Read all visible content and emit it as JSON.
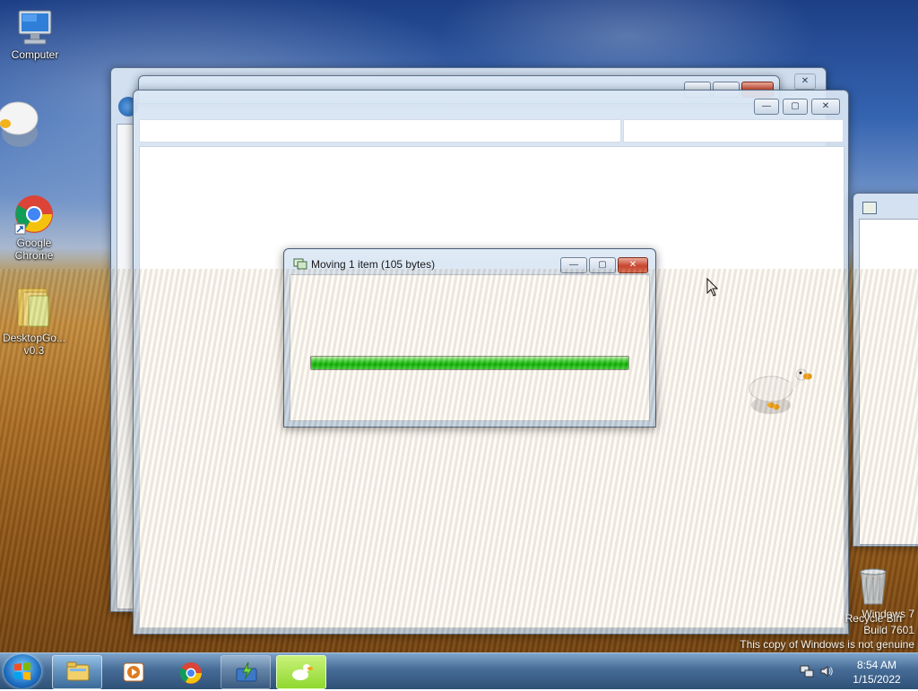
{
  "desktop": {
    "icons": [
      {
        "label": "Computer"
      },
      {
        "label": "Google\nChrome"
      },
      {
        "label": "DesktopGo...\nv0.3"
      }
    ],
    "recycle_bin": {
      "label": "Recycle Bin"
    }
  },
  "dialog": {
    "title": "Moving 1 item (105 bytes)",
    "progress_fraction": 1.0,
    "buttons": {
      "minimize": "—",
      "maximize": "▢",
      "close": "✕"
    }
  },
  "windows": {
    "bg_window_buttons": {
      "minimize": "—",
      "maximize": "▢",
      "close": "✕"
    }
  },
  "watermark": {
    "line1": "Windows 7",
    "line2": "Build 7601",
    "line3": "This copy of Windows is not genuine"
  },
  "taskbar": {
    "items": [
      {
        "name": "file-explorer-task",
        "active": true
      },
      {
        "name": "media-player-task",
        "active": false
      },
      {
        "name": "chrome-task",
        "active": false
      },
      {
        "name": "file-transfer-task",
        "active": false
      },
      {
        "name": "goose-task",
        "active": true
      }
    ],
    "clock": {
      "time": "8:54 AM",
      "date": "1/15/2022"
    }
  },
  "colors": {
    "progress": "#06b406",
    "close_button": "#c7452e",
    "taskbar": "#3c6491"
  }
}
